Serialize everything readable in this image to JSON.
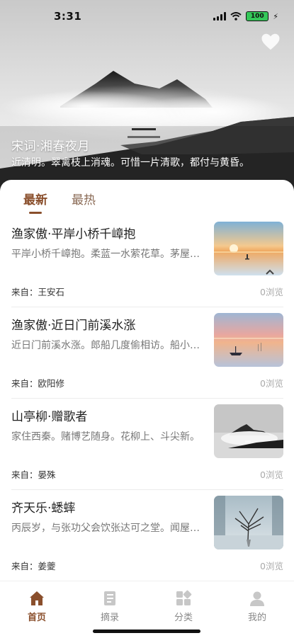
{
  "status_bar": {
    "time": "3:31",
    "battery": "100"
  },
  "hero": {
    "title": "宋词·湘春夜月",
    "excerpt": "近清明。翠禽枝上消魂。可惜一片清歌，都付与黄昏。"
  },
  "tabs": [
    {
      "label": "最新",
      "active": true
    },
    {
      "label": "最热",
      "active": false
    }
  ],
  "articles": [
    {
      "title": "渔家傲·平岸小桥千嶂抱",
      "excerpt": "平岸小桥千嶂抱。柔蓝一水萦花草。茅屋数间窗窈窕。",
      "source": "来自：王安石",
      "views": "0浏览"
    },
    {
      "title": "渔家傲·近日门前溪水涨",
      "excerpt": "近日门前溪水涨。郎船几度偷相访。船小难开红斗帐。",
      "source": "来自：欧阳修",
      "views": "0浏览"
    },
    {
      "title": "山亭柳·赠歌者",
      "excerpt": "家住西秦。赌博艺随身。花柳上、斗尖新。",
      "source": "来自：晏殊",
      "views": "0浏览"
    },
    {
      "title": "齐天乐·蟋蟀",
      "excerpt": "丙辰岁，与张功父会饮张达可之堂。闻屋壁间蟋蟀有声。",
      "source": "来自：姜夔",
      "views": "0浏览"
    }
  ],
  "bottom_nav": [
    {
      "label": "首页",
      "icon": "home-icon",
      "active": true
    },
    {
      "label": "摘录",
      "icon": "notebook-icon",
      "active": false
    },
    {
      "label": "分类",
      "icon": "category-icon",
      "active": false
    },
    {
      "label": "我的",
      "icon": "profile-icon",
      "active": false
    }
  ],
  "colors": {
    "accent": "#8a4f2c",
    "battery_green": "#35c759",
    "muted_text": "#888888"
  }
}
